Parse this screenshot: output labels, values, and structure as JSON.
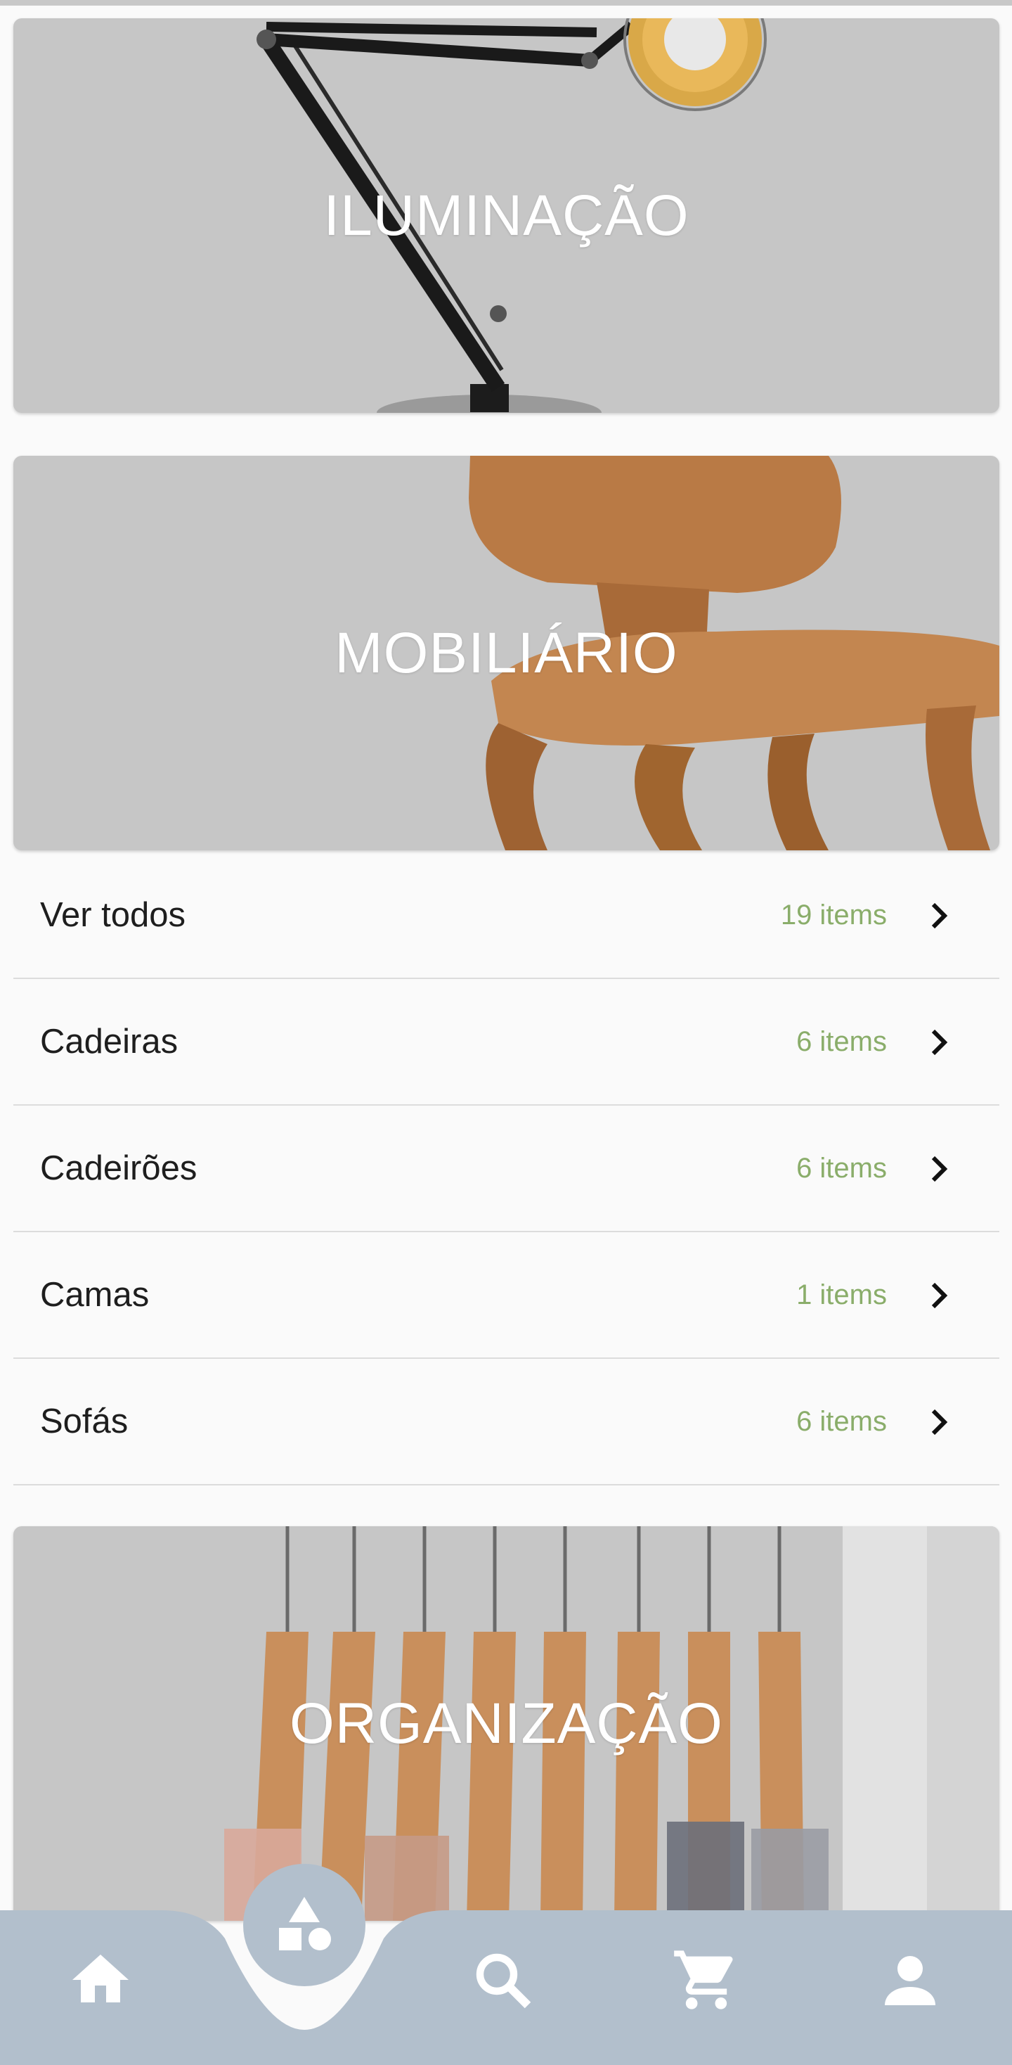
{
  "categories": [
    {
      "title": "ILUMINAÇÃO"
    },
    {
      "title": "MOBILIÁRIO"
    },
    {
      "title": "ORGANIZAÇÃO"
    }
  ],
  "subcategories": [
    {
      "label": "Ver todos",
      "count": "19 items"
    },
    {
      "label": "Cadeiras",
      "count": "6 items"
    },
    {
      "label": "Cadeirões",
      "count": "6 items"
    },
    {
      "label": "Camas",
      "count": "1 items"
    },
    {
      "label": "Sofás",
      "count": "6 items"
    }
  ],
  "nav": {
    "items": [
      "home-icon",
      "categories-icon",
      "search-icon",
      "cart-icon",
      "profile-icon"
    ],
    "active": "categories-icon"
  },
  "colors": {
    "card_bg": "#c6c6c6",
    "count_green": "#8aad6a",
    "nav_bg": "#b2bfcc",
    "page_bg": "#fafafa"
  }
}
